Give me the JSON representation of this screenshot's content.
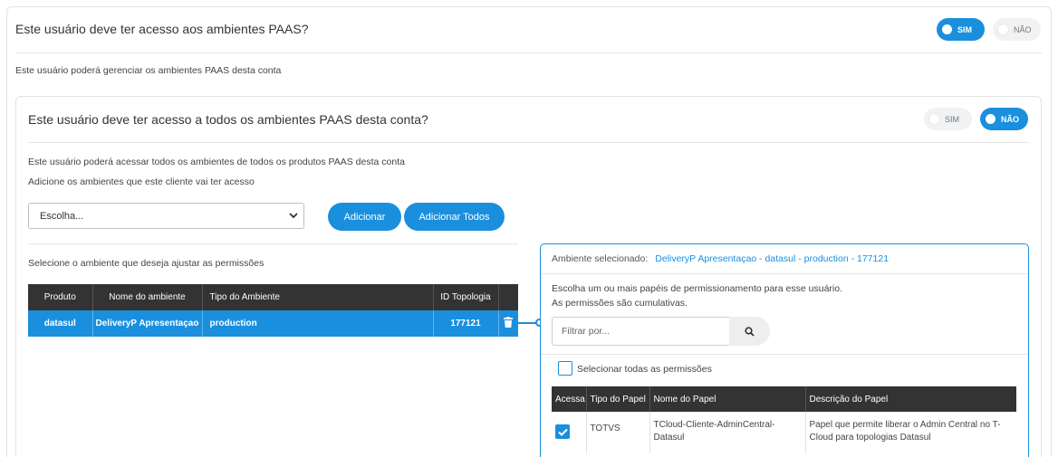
{
  "main_question": "Este usuário deve ter acesso aos ambientes PAAS?",
  "main_toggle": {
    "yes": "SIM",
    "no": "NÃO",
    "selected": "yes"
  },
  "main_hint": "Este usuário poderá gerenciar os ambientes PAAS desta conta",
  "inner_question": "Este usuário deve ter acesso a todos os ambientes PAAS desta conta?",
  "inner_toggle": {
    "yes": "SIM",
    "no": "NÃO",
    "selected": "no"
  },
  "inner_hint_1": "Este usuário poderá acessar todos os ambientes de todos os produtos PAAS desta conta",
  "inner_hint_2": "Adicione os ambientes que este cliente vai ter acesso",
  "select": {
    "value": "Escolha..."
  },
  "buttons": {
    "add": "Adicionar",
    "add_all": "Adicionar Todos"
  },
  "env_hint": "Selecione o ambiente que deseja ajustar as permissões",
  "env_table": {
    "headers": [
      "Produto",
      "Nome do ambiente",
      "Tipo do Ambiente",
      "ID Topologia"
    ],
    "rows": [
      {
        "produto": "datasul",
        "nome": "DeliveryP Apresentaçao",
        "tipo": "production",
        "id": "177121"
      }
    ]
  },
  "perm_panel": {
    "label": "Ambiente selecionado:",
    "env_name": "DeliveryP Apresentaçao - datasul - production - 177121",
    "desc_1": "Escolha um ou mais papéis de permissionamento para esse usuário.",
    "desc_2": "As permissões são cumulativas.",
    "filter_placeholder": "Filtrar por...",
    "select_all": "Selecionar todas as permissões",
    "headers": [
      "Acessa",
      "Tipo do Papel",
      "Nome do Papel",
      "Descrição do Papel"
    ],
    "rows": [
      {
        "tipo": "TOTVS",
        "nome": "TCloud-Cliente-AdminCentral-Datasul",
        "descricao": "Papel que permite liberar o Admin Central no T-Cloud para topologias Datasul",
        "checked": true
      }
    ]
  },
  "colors": {
    "accent": "#1a8fdd",
    "header_dark": "#333333"
  }
}
